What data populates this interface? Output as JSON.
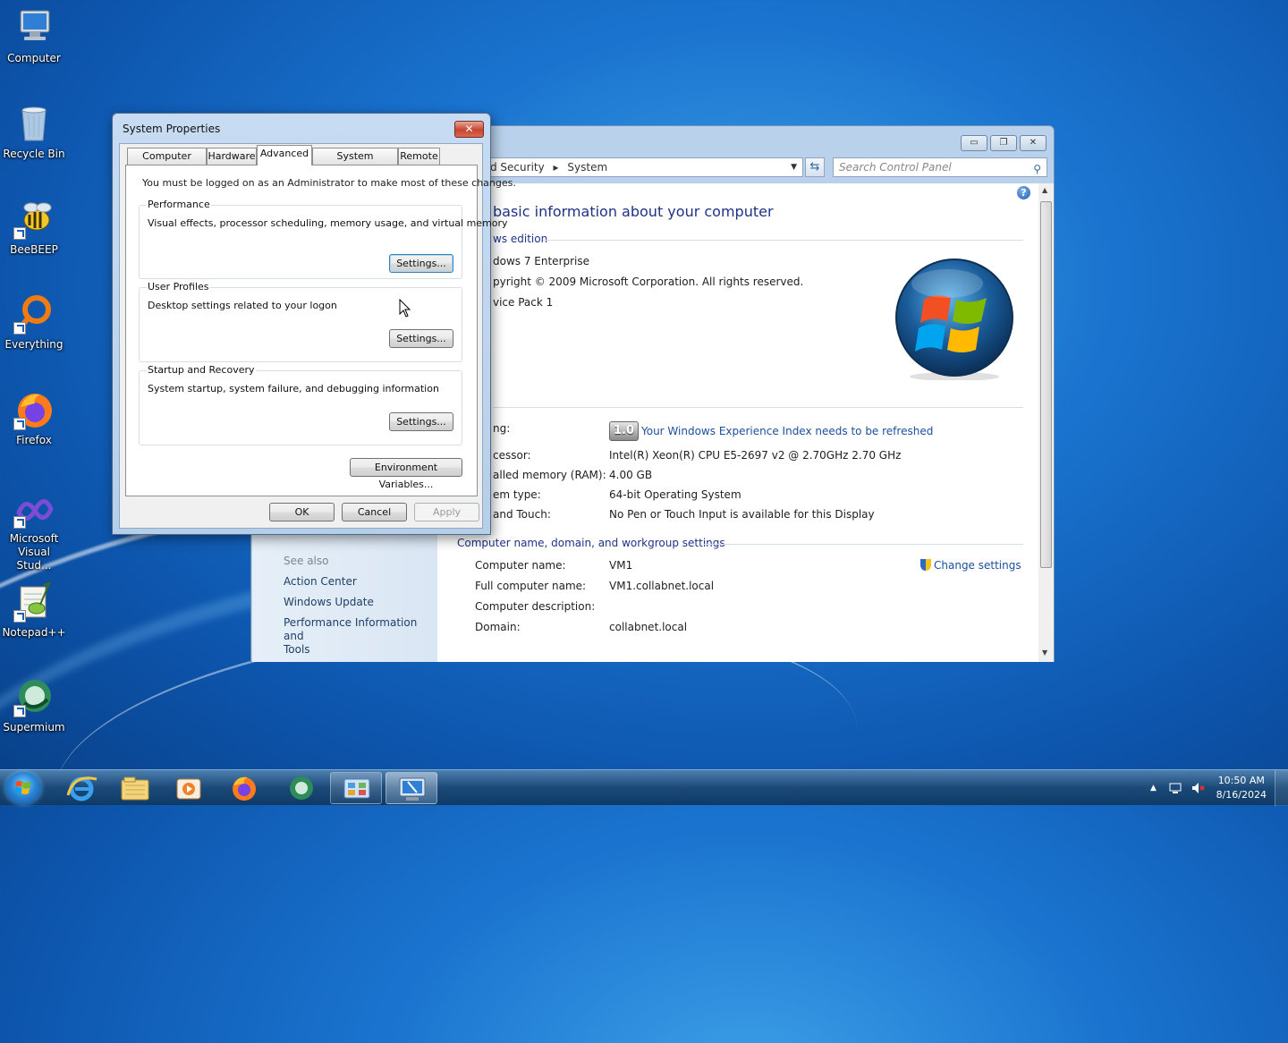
{
  "desktop_icons": [
    {
      "label": "Computer",
      "icon": "computer-icon"
    },
    {
      "label": "Recycle Bin",
      "icon": "recycle-bin-icon"
    },
    {
      "label": "BeeBEEP",
      "icon": "beebeep-icon"
    },
    {
      "label": "Everything",
      "icon": "everything-icon"
    },
    {
      "label": "Firefox",
      "icon": "firefox-icon"
    },
    {
      "label": "Microsoft Visual Stud...",
      "line1": "Microsoft",
      "line2": "Visual Stud...",
      "icon": "visual-studio-icon"
    },
    {
      "label": "Notepad++",
      "icon": "notepadpp-icon"
    },
    {
      "label": "Supermium",
      "icon": "supermium-icon"
    }
  ],
  "control_panel": {
    "address": {
      "part1": "d Security",
      "part2": "System"
    },
    "search_placeholder": "Search Control Panel",
    "heading": "basic information about your computer",
    "edition_section": "ws edition",
    "edition": "dows 7 Enterprise",
    "copyright": "pyright © 2009 Microsoft Corporation.  All rights reserved.",
    "service_pack": "vice Pack 1",
    "system_rows": [
      {
        "label": "ng:",
        "value": "Your Windows Experience Index needs to be refreshed",
        "badge": "1.0"
      },
      {
        "label": "cessor:",
        "value": "Intel(R) Xeon(R) CPU E5-2697 v2 @ 2.70GHz   2.70 GHz"
      },
      {
        "label": "alled memory (RAM):",
        "value": "4.00 GB"
      },
      {
        "label": "em type:",
        "value": "64-bit Operating System"
      },
      {
        "label": " and Touch:",
        "value": "No Pen or Touch Input is available for this Display"
      }
    ],
    "computer_section": "Computer name, domain, and workgroup settings",
    "computer_rows": [
      {
        "label": "Computer name:",
        "value": "VM1"
      },
      {
        "label": "Full computer name:",
        "value": "VM1.collabnet.local"
      },
      {
        "label": "Computer description:",
        "value": ""
      },
      {
        "label": "Domain:",
        "value": "collabnet.local"
      }
    ],
    "change_settings": "Change settings",
    "see_also": "See also",
    "see_also_links": [
      "Action Center",
      "Windows Update",
      "Performance Information and Tools"
    ],
    "perf_line1": "Performance Information and",
    "perf_line2": "Tools"
  },
  "system_properties": {
    "title": "System Properties",
    "tabs": [
      "Computer Name",
      "Hardware",
      "Advanced",
      "System Protection",
      "Remote"
    ],
    "active_tab": "Advanced",
    "admin_note": "You must be logged on as an Administrator to make most of these changes.",
    "groups": [
      {
        "title": "Performance",
        "desc": "Visual effects, processor scheduling, memory usage, and virtual memory",
        "button": "Settings..."
      },
      {
        "title": "User Profiles",
        "desc": "Desktop settings related to your logon",
        "button": "Settings..."
      },
      {
        "title": "Startup and Recovery",
        "desc": "System startup, system failure, and debugging information",
        "button": "Settings..."
      }
    ],
    "env_button": "Environment Variables...",
    "ok": "OK",
    "cancel": "Cancel",
    "apply": "Apply"
  },
  "taskbar": {
    "items": [
      "internet-explorer-icon",
      "explorer-icon",
      "media-player-icon",
      "firefox-icon",
      "supermium-icon",
      "control-panel-icon",
      "system-properties-icon"
    ],
    "time": "10:50 AM",
    "date": "8/16/2024"
  }
}
